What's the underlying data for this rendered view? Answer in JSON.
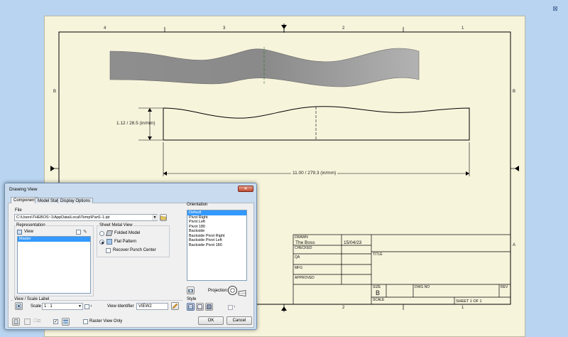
{
  "sheet": {
    "zone_numbers_top": [
      "4",
      "3",
      "2",
      "1"
    ],
    "zone_numbers_bottom": [
      "2",
      "1"
    ],
    "zone_letters_left": [
      "B"
    ],
    "zone_letters_right": [
      "B",
      "A"
    ],
    "dim_height": "1.12 / 28.5  (in/mm)",
    "dim_width": "11.00 / 279.3  (in/mm)"
  },
  "title_block": {
    "drawn_label": "DRAWN",
    "drawn_name": "The Boss",
    "drawn_date": "15/04/23",
    "checked_label": "CHECKED",
    "qa_label": "QA",
    "mfg_label": "MFG",
    "approved_label": "APPROVED",
    "title_label": "TITLE",
    "size_label": "SIZE",
    "size_value": "B",
    "dwg_no_label": "DWG NO",
    "rev_label": "REV",
    "scale_label": "SCALE",
    "sheet_label": "SHEET 1   OF 1"
  },
  "dialog": {
    "title": "Drawing View",
    "tabs": [
      "Component",
      "Model State",
      "Display Options"
    ],
    "file_label": "File",
    "file_path": "C:\\Users\\THEBOS~1\\AppData\\Local\\Temp\\Part1-1.ipt",
    "representation_label": "Representation",
    "view_label": "View",
    "view_item": "Master",
    "sheet_metal_label": "Sheet Metal View",
    "folded_label": "Folded Model",
    "flat_label": "Flat Pattern",
    "recover_label": "Recover Punch Center",
    "orientation_label": "Orientation",
    "orientations": [
      "Default",
      "Pivot Right",
      "Pivot Left",
      "Pivot 180",
      "Backside",
      "Backside Pivot Right",
      "Backside Pivot Left",
      "Backside Pivot 180"
    ],
    "projection_label": "Projection:",
    "view_scale_label": "View / Scale Label",
    "scale_label": "Scale",
    "scale_value": "1 : 1",
    "view_identifier_label": "View Identifier",
    "view_identifier_value": "VIEW2",
    "style_label": "Style",
    "raster_label": "Raster View Only",
    "ok_label": "OK",
    "cancel_label": "Cancel"
  }
}
